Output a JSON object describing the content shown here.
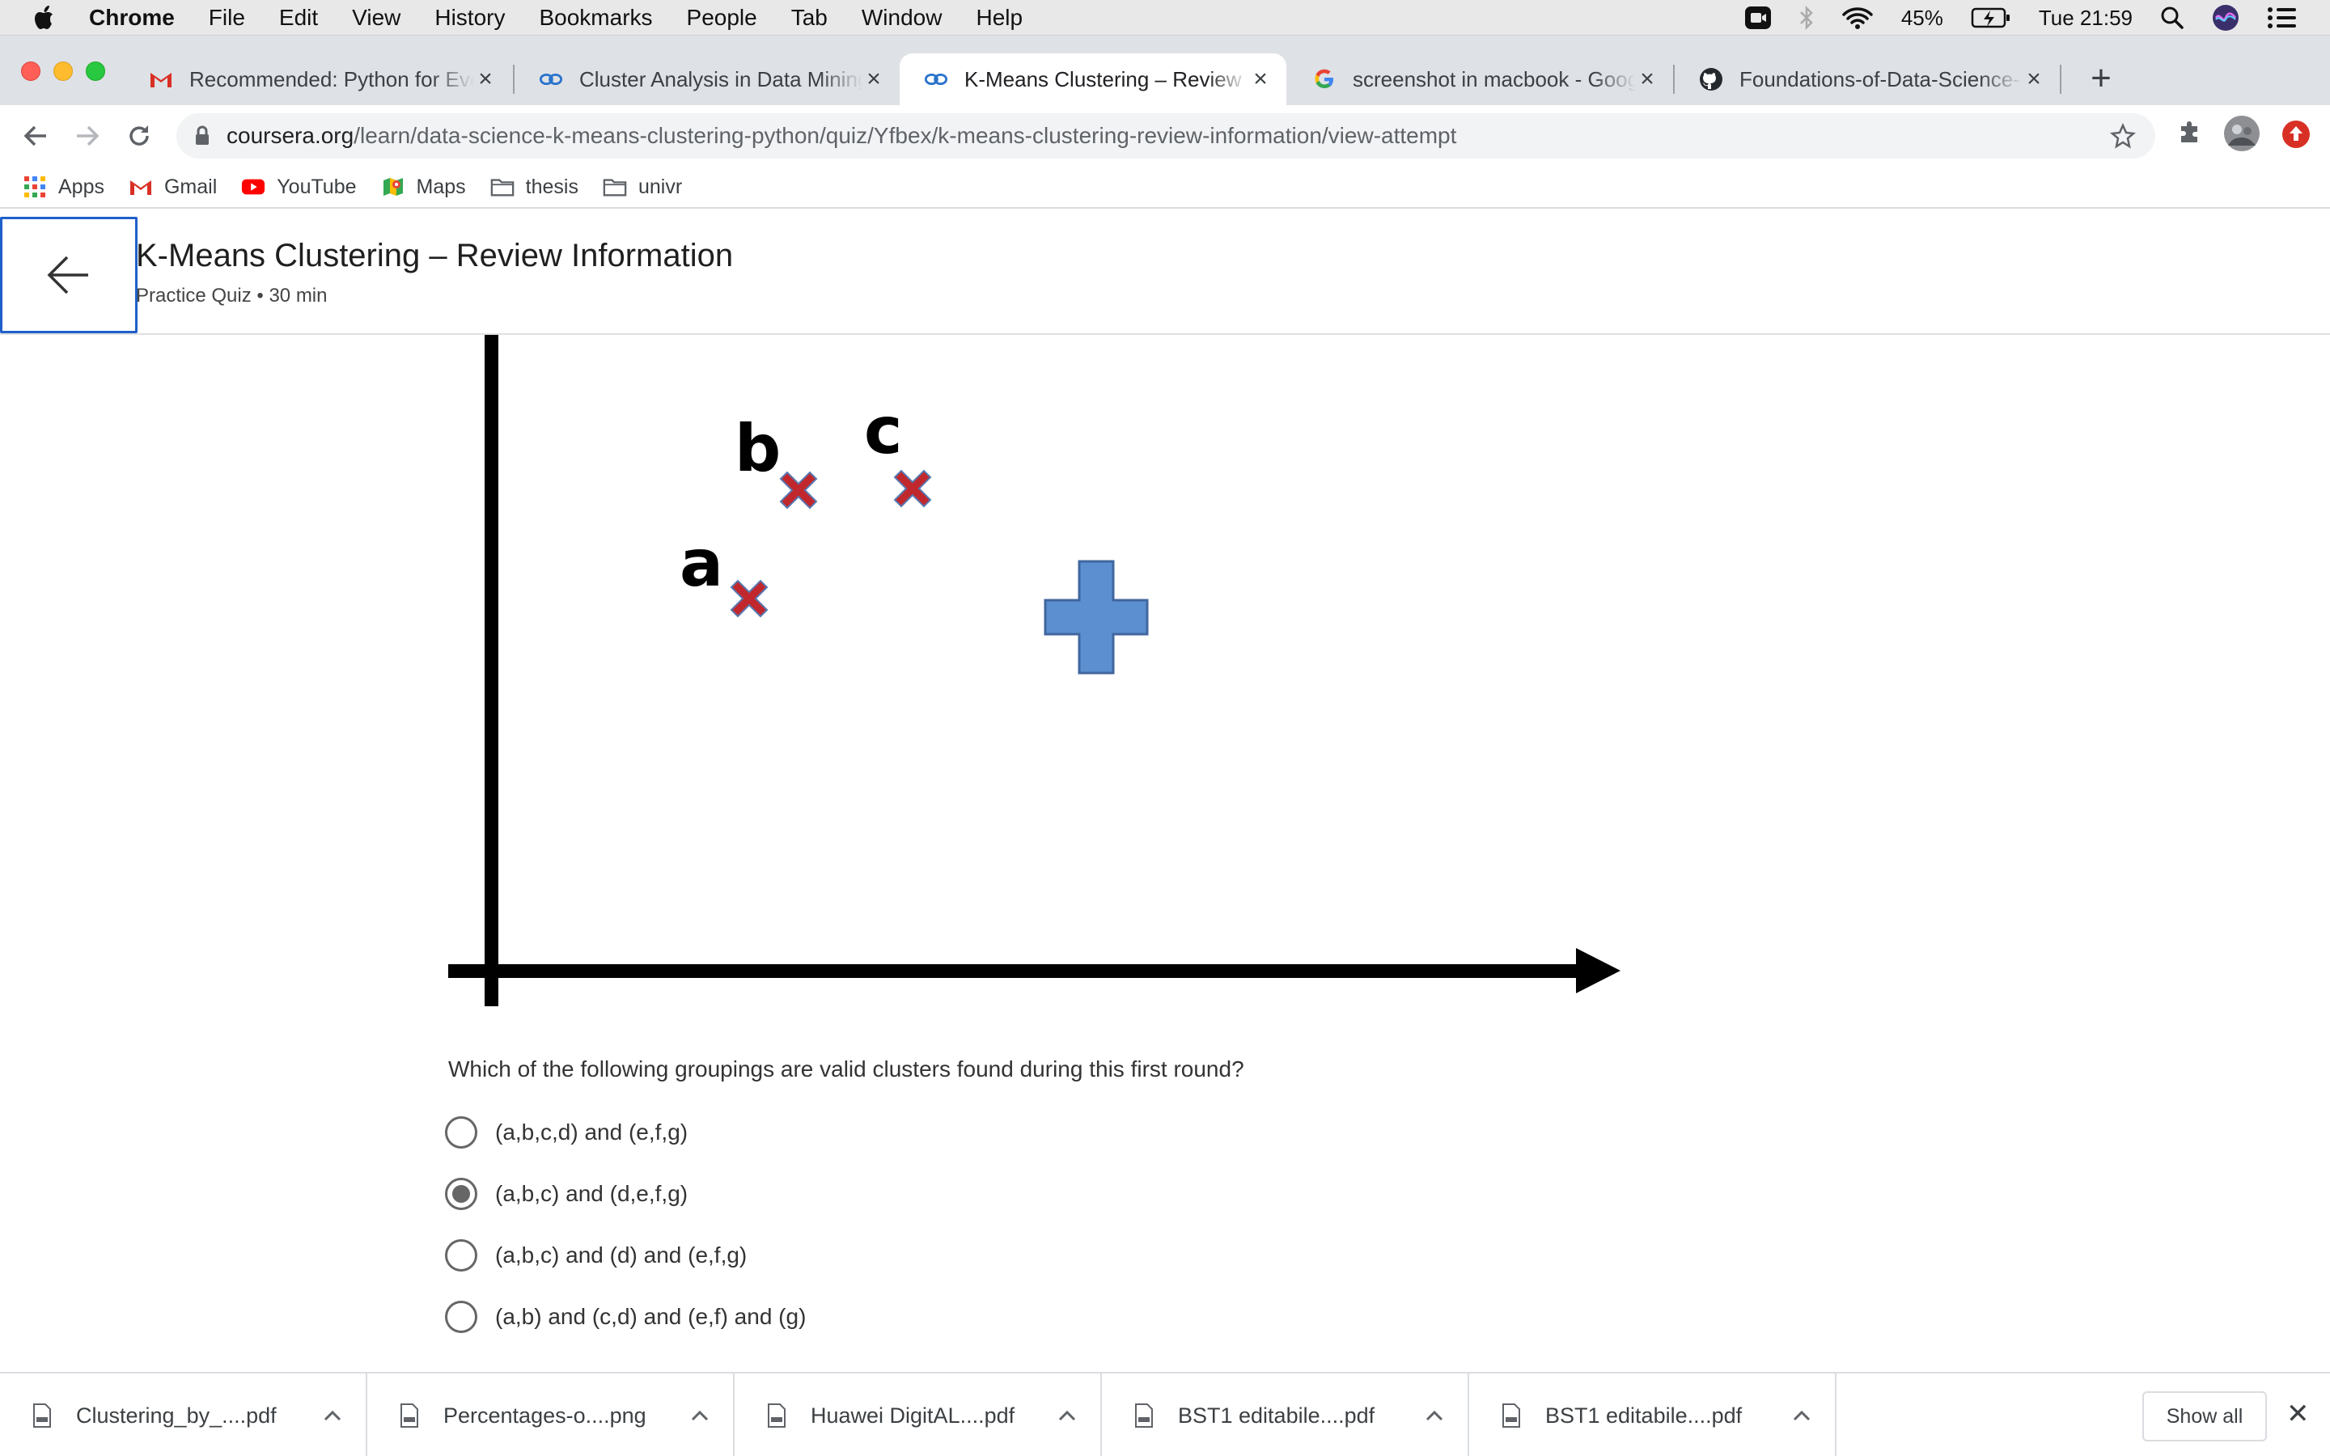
{
  "menubar": {
    "app": "Chrome",
    "items": [
      "File",
      "Edit",
      "View",
      "History",
      "Bookmarks",
      "People",
      "Tab",
      "Window",
      "Help"
    ],
    "battery": "45%",
    "clock": "Tue 21:59"
  },
  "tabs": [
    {
      "title": "Recommended: Python for Eve",
      "icon": "gmail-icon",
      "active": false
    },
    {
      "title": "Cluster Analysis in Data Mining",
      "icon": "coursera-icon",
      "active": false
    },
    {
      "title": "K-Means Clustering – Review In",
      "icon": "coursera-icon",
      "active": true
    },
    {
      "title": "screenshot in macbook - Goog",
      "icon": "google-icon",
      "active": false
    },
    {
      "title": "Foundations-of-Data-Science-",
      "icon": "github-icon",
      "active": false
    }
  ],
  "address": {
    "host": "coursera.org",
    "path": "/learn/data-science-k-means-clustering-python/quiz/Yfbex/k-means-clustering-review-information/view-attempt"
  },
  "bookmarks": [
    {
      "label": "Apps",
      "icon": "apps-grid-icon"
    },
    {
      "label": "Gmail",
      "icon": "gmail-icon"
    },
    {
      "label": "YouTube",
      "icon": "youtube-icon"
    },
    {
      "label": "Maps",
      "icon": "maps-icon"
    },
    {
      "label": "thesis",
      "icon": "folder-icon"
    },
    {
      "label": "univr",
      "icon": "folder-icon"
    }
  ],
  "course": {
    "title": "K-Means Clustering – Review Information",
    "subtitle": "Practice Quiz • 30 min"
  },
  "diagram": {
    "points": [
      {
        "label": "a"
      },
      {
        "label": "b"
      },
      {
        "label": "c"
      }
    ],
    "colors": {
      "point": "#c0282d",
      "centroid": "#5b8fd0"
    }
  },
  "quiz": {
    "question": "Which of the following groupings are valid clusters found during this first round?",
    "options": [
      {
        "label": "(a,b,c,d) and (e,f,g)",
        "selected": false
      },
      {
        "label": "(a,b,c) and (d,e,f,g)",
        "selected": true
      },
      {
        "label": "(a,b,c) and (d) and (e,f,g)",
        "selected": false
      },
      {
        "label": "(a,b) and (c,d) and (e,f) and (g)",
        "selected": false
      }
    ]
  },
  "downloads": {
    "items": [
      "Clustering_by_....pdf",
      "Percentages-o....png",
      "Huawei DigitAL....pdf",
      "BST1 editabile....pdf",
      "BST1 editabile....pdf"
    ],
    "show_all": "Show all"
  }
}
